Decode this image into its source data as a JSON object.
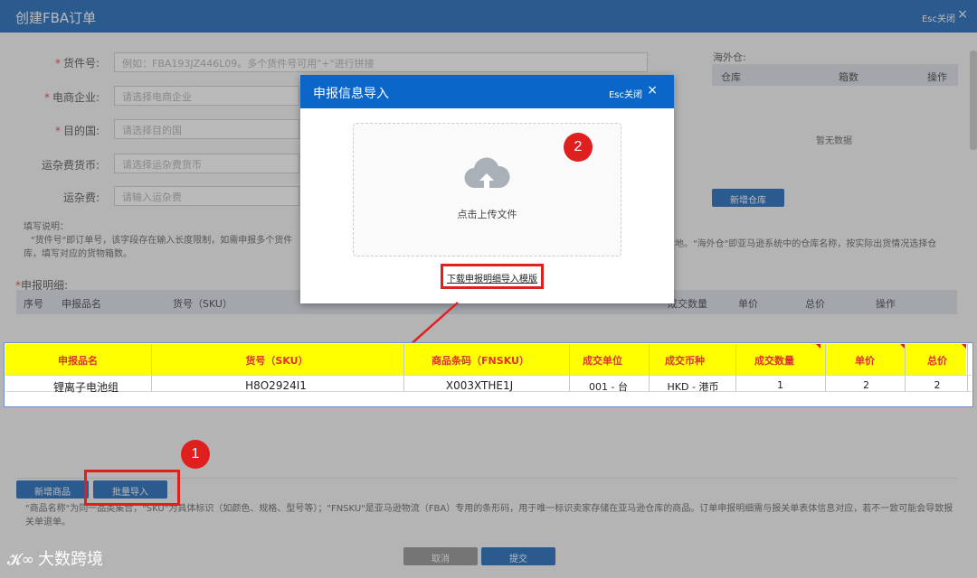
{
  "header": {
    "title": "创建FBA订单",
    "esc_label": "Esc关闭",
    "close_icon": "×"
  },
  "form": {
    "fields": [
      {
        "label": "货件号:",
        "placeholder": "例如：FBA193JZ446L09。多个货件号可用\"+\"进行拼接",
        "required": true
      },
      {
        "label": "电商企业:",
        "placeholder": "请选择电商企业",
        "required": true
      },
      {
        "label": "目的国:",
        "placeholder": "请选择目的国",
        "required": true
      },
      {
        "label": "运杂费货币:",
        "placeholder": "请选择运杂费货币",
        "required": false
      },
      {
        "label": "运杂费:",
        "placeholder": "请输入运杂费",
        "required": false
      }
    ],
    "note_title": "填写说明：",
    "note_text": "\"货件号\"即订单号，该字段存在输入长度限制，如需申报多个货件",
    "note_text2": "库，填写对应的货物箱数。",
    "note_right": "地。\"海外仓\"即亚马逊系统中的仓库名称，按实际出货情况选择仓"
  },
  "overseas": {
    "label": "海外仓:",
    "columns": [
      "仓库",
      "箱数",
      "操作"
    ],
    "empty_text": "暂无数据",
    "add_button": "新增仓库"
  },
  "details": {
    "label": "申报明细:",
    "columns": [
      "序号",
      "申报品名",
      "货号（SKU）",
      "成交数量",
      "单价",
      "总价",
      "操作"
    ]
  },
  "modal": {
    "title": "申报信息导入",
    "esc_label": "Esc关闭",
    "upload_text": "点击上传文件",
    "download_link": "下载申报明细导入模版",
    "badge": "2"
  },
  "template_table": {
    "headers": [
      "申报品名",
      "货号（SKU）",
      "商品条码（FNSKU）",
      "成交单位",
      "成交币种",
      "成交数量",
      "单价",
      "总价"
    ],
    "row": [
      "锂离子电池组",
      "H8O2924I1",
      "X003XTHE1J",
      "001 - 台",
      "HKD - 港币",
      "1",
      "2",
      "2"
    ]
  },
  "actions": {
    "add_product": "新增商品",
    "batch_import": "批量导入",
    "badge": "1",
    "cancel": "取消",
    "submit": "提交"
  },
  "bottom_note": "\"商品名称\"为同一品类集合，\"SKU\"为具体标识（如颜色、规格、型号等）；\"FNSKU\"是亚马逊物流（FBA）专用的条形码，用于唯一标识卖家存储在亚马逊仓库的商品。订单申报明细需与报关单表体信息对应，若不一致可能会导致报关单退单。",
  "watermark": "大数跨境",
  "colors": {
    "primary": "#0a5bb5",
    "highlight": "#ffff00",
    "alert_red": "#e0201f"
  }
}
